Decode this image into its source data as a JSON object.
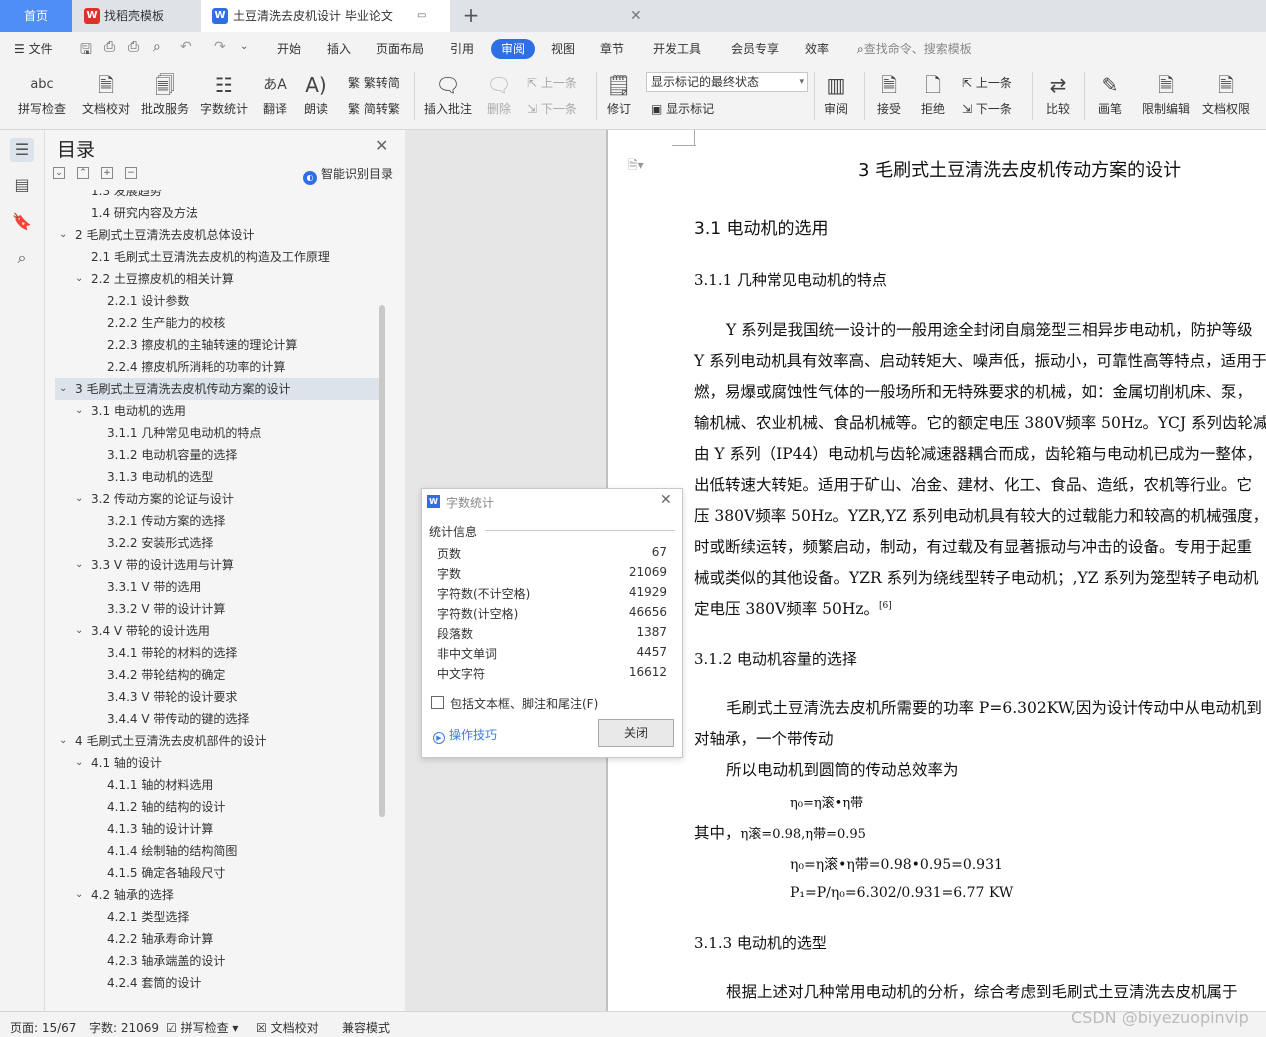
{
  "tabs": {
    "home": "首页",
    "template": "找稻壳模板",
    "document": "土豆清洗去皮机设计 毕业论文",
    "add": "+"
  },
  "menu": {
    "file": "文件",
    "items": [
      "开始",
      "插入",
      "页面布局",
      "引用",
      "审阅",
      "视图",
      "章节",
      "开发工具",
      "会员专享",
      "效率"
    ],
    "active": "审阅",
    "search_placeholder": "查找命令、搜索模板"
  },
  "ribbon": {
    "spell_check": "拼写检查",
    "doc_proof": "文档校对",
    "revise_service": "批改服务",
    "word_count": "字数统计",
    "translate": "翻译",
    "read_aloud": "朗读",
    "trad_to_simp": "繁转简",
    "simp_to_trad": "简转繁",
    "insert_comment": "插入批注",
    "delete": "删除",
    "prev": "上一条",
    "next": "下一条",
    "revise": "修订",
    "markup_state": "显示标记的最终状态",
    "show_markup": "显示标记",
    "review": "审阅",
    "accept": "接受",
    "reject": "拒绝",
    "prev2": "上一条",
    "next2": "下一条",
    "compare": "比较",
    "pen": "画笔",
    "restrict_edit": "限制编辑",
    "doc_permission": "文档权限",
    "icons": {
      "spell": "abc",
      "translate": "あA"
    }
  },
  "toc": {
    "title": "目录",
    "ai_recognize": "智能识别目录",
    "items": [
      {
        "label": "1.3  发展趋势",
        "level": 2,
        "arrow": false
      },
      {
        "label": "1.4 研究内容及方法",
        "level": 2,
        "arrow": false
      },
      {
        "label": "2 毛刷式土豆清洗去皮机总体设计",
        "level": 1,
        "arrow": true
      },
      {
        "label": "2.1 毛刷式土豆清洗去皮机的构造及工作原理",
        "level": 2,
        "arrow": false
      },
      {
        "label": "2.2  土豆擦皮机的相关计算",
        "level": 2,
        "arrow": true
      },
      {
        "label": "2.2.1 设计参数",
        "level": 3,
        "arrow": false
      },
      {
        "label": "2.2.2 生产能力的校核",
        "level": 3,
        "arrow": false
      },
      {
        "label": "2.2.3 擦皮机的主轴转速的理论计算",
        "level": 3,
        "arrow": false
      },
      {
        "label": "2.2.4  擦皮机所消耗的功率的计算",
        "level": 3,
        "arrow": false
      },
      {
        "label": "3 毛刷式土豆清洗去皮机传动方案的设计",
        "level": 1,
        "arrow": true,
        "selected": true
      },
      {
        "label": "3.1 电动机的选用",
        "level": 2,
        "arrow": true
      },
      {
        "label": "3.1.1  几种常见电动机的特点",
        "level": 3,
        "arrow": false
      },
      {
        "label": "3.1.2  电动机容量的选择",
        "level": 3,
        "arrow": false
      },
      {
        "label": "3.1.3  电动机的选型",
        "level": 3,
        "arrow": false
      },
      {
        "label": "3.2 传动方案的论证与设计",
        "level": 2,
        "arrow": true
      },
      {
        "label": "3.2.1 传动方案的选择",
        "level": 3,
        "arrow": false
      },
      {
        "label": "3.2.2 安装形式选择",
        "level": 3,
        "arrow": false
      },
      {
        "label": "3.3 V 带的设计选用与计算",
        "level": 2,
        "arrow": true
      },
      {
        "label": "3.3.1 V 带的选用",
        "level": 3,
        "arrow": false
      },
      {
        "label": "3.3.2 V 带的设计计算",
        "level": 3,
        "arrow": false
      },
      {
        "label": "3.4 V 带轮的设计选用",
        "level": 2,
        "arrow": true
      },
      {
        "label": "3.4.1 带轮的材料的选择",
        "level": 3,
        "arrow": false
      },
      {
        "label": "3.4.2 带轮结构的确定",
        "level": 3,
        "arrow": false
      },
      {
        "label": "3.4.3 V 带轮的设计要求",
        "level": 3,
        "arrow": false
      },
      {
        "label": "3.4.4 V 带传动的键的选择",
        "level": 3,
        "arrow": false
      },
      {
        "label": "4 毛刷式土豆清洗去皮机部件的设计",
        "level": 1,
        "arrow": true
      },
      {
        "label": "4.1 轴的设计",
        "level": 2,
        "arrow": true
      },
      {
        "label": "4.1.1 轴的材料选用",
        "level": 3,
        "arrow": false
      },
      {
        "label": "4.1.2 轴的结构的设计",
        "level": 3,
        "arrow": false
      },
      {
        "label": "4.1.3 轴的设计计算",
        "level": 3,
        "arrow": false
      },
      {
        "label": "4.1.4 绘制轴的结构简图",
        "level": 3,
        "arrow": false
      },
      {
        "label": "4.1.5 确定各轴段尺寸",
        "level": 3,
        "arrow": false
      },
      {
        "label": "4.2 轴承的选择",
        "level": 2,
        "arrow": true
      },
      {
        "label": "4.2.1 类型选择",
        "level": 3,
        "arrow": false
      },
      {
        "label": "4.2.2 轴承寿命计算",
        "level": 3,
        "arrow": false
      },
      {
        "label": "4.2.3 轴承端盖的设计",
        "level": 3,
        "arrow": false
      },
      {
        "label": "4.2.4 套筒的设计",
        "level": 3,
        "arrow": false
      }
    ]
  },
  "document": {
    "chapter_title": "3 毛刷式土豆清洗去皮机传动方案的设计",
    "section": "3.1 电动机的选用",
    "sub1": "3.1.1  几种常见电动机的特点",
    "para1": [
      "Y 系列是我国统一设计的一般用途全封闭自扇笼型三相异步电动机，防护等级",
      "Y 系列电动机具有效率高、启动转矩大、噪声低，振动小，可靠性高等特点，适用于",
      "燃，易爆或腐蚀性气体的一般场所和无特殊要求的机械，如：金属切削机床、泵，",
      "输机械、农业机械、食品机械等。它的额定电压 380V频率 50Hz。YCJ 系列齿轮减",
      "由 Y 系列（IP44）电动机与齿轮减速器耦合而成，齿轮箱与电动机已成为一整体，",
      "出低转速大转矩。适用于矿山、冶金、建材、化工、食品、造纸，农机等行业。它",
      "压 380V频率 50Hz。YZR,YZ 系列电动机具有较大的过载能力和较高的机械强度，",
      "时或断续运转，频繁启动，制动，有过载及有显著振动与冲击的设备。专用于起重",
      "械或类似的其他设备。YZR 系列为绕线型转子电动机；,YZ 系列为笼型转子电动机",
      "定电压 380V频率 50Hz。"
    ],
    "ref": "[6]",
    "sub2": "3.1.2  电动机容量的选择",
    "para2a": "毛刷式土豆清洗去皮机所需要的功率 P=6.302KW,因为设计传动中从电动机到",
    "para2b": "对轴承，一个带传动",
    "para2c": "所以电动机到圆筒的传动总效率为",
    "eq1": "η₀=η滚•η带",
    "eq2_prefix": "其中，",
    "eq2": "η滚=0.98,η带=0.95",
    "eq3": "η₀=η滚•η带=0.98•0.95=0.931",
    "eq4": "P₁=P/η₀=6.302/0.931=6.77 KW",
    "sub3": "3.1.3  电动机的选型",
    "para3": "根据上述对几种常用电动机的分析，综合考虑到毛刷式土豆清洗去皮机属于"
  },
  "dialog": {
    "title": "字数统计",
    "section": "统计信息",
    "rows": [
      {
        "label": "页数",
        "value": "67"
      },
      {
        "label": "字数",
        "value": "21069"
      },
      {
        "label": "字符数(不计空格)",
        "value": "41929"
      },
      {
        "label": "字符数(计空格)",
        "value": "46656"
      },
      {
        "label": "段落数",
        "value": "1387"
      },
      {
        "label": "非中文单词",
        "value": "4457"
      },
      {
        "label": "中文字符",
        "value": "16612"
      }
    ],
    "checkbox_label": "包括文本框、脚注和尾注(F)",
    "checkbox_checked": false,
    "tips": "操作技巧",
    "close": "关闭"
  },
  "status": {
    "page": "页面: 15/67",
    "words": "字数: 21069",
    "spell": "拼写检查",
    "proof": "文档校对",
    "compat": "兼容模式"
  },
  "watermark": "CSDN @biyezuopinvip",
  "colors": {
    "accent": "#2f6fe4",
    "home_tab": "#4f8ef7",
    "template_icon": "#e0302b",
    "selected_row": "#dde3ea"
  }
}
